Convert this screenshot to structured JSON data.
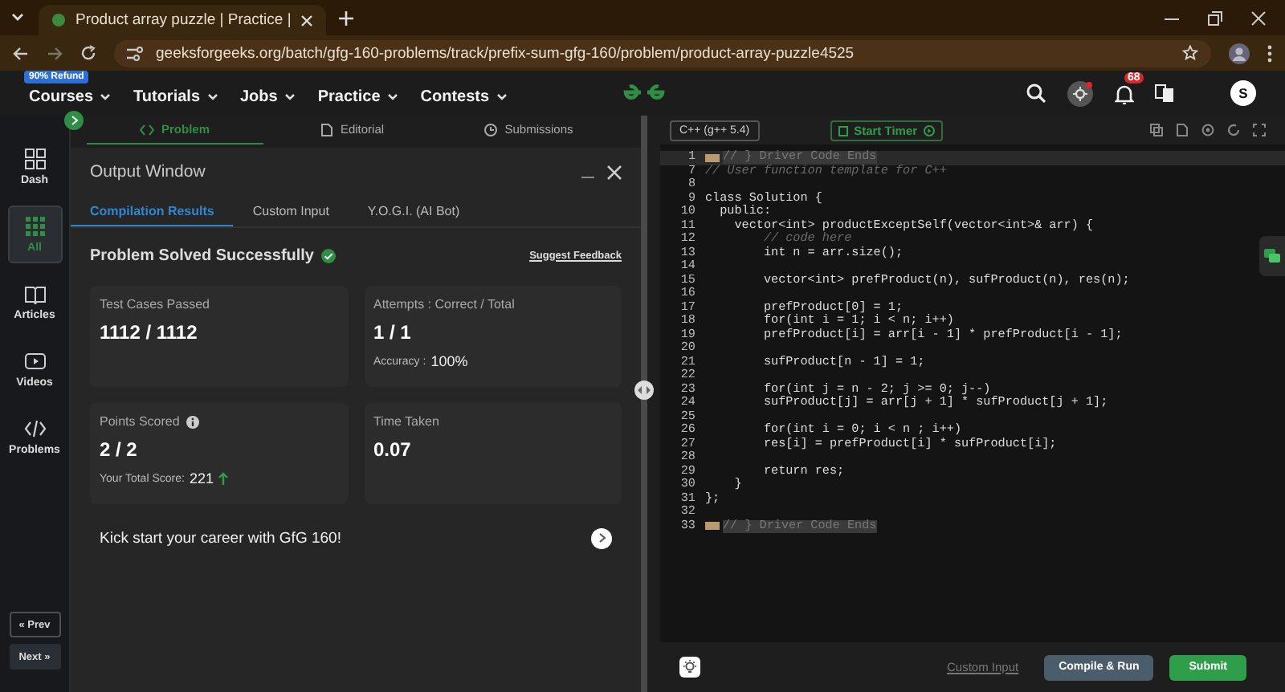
{
  "browser": {
    "tab_title": "Product array puzzle | Practice |",
    "url": "geeksforgeeks.org/batch/gfg-160-problems/track/prefix-sum-gfg-160/problem/product-array-puzzle4525"
  },
  "nav": {
    "badge": "90% Refund",
    "items": [
      "Courses",
      "Tutorials",
      "Jobs",
      "Practice",
      "Contests"
    ],
    "notification_count": "68",
    "avatar": "S"
  },
  "sidebar": {
    "items": [
      {
        "label": "Dash",
        "kind": "dash",
        "selected": false
      },
      {
        "label": "All",
        "kind": "grid",
        "selected": true
      },
      {
        "label": "Articles",
        "kind": "book",
        "selected": false
      },
      {
        "label": "Videos",
        "kind": "video",
        "selected": false
      },
      {
        "label": "Problems",
        "kind": "code",
        "selected": false
      }
    ],
    "prev": "« Prev",
    "next": "Next »"
  },
  "problem_tabs": [
    {
      "label": "Problem",
      "kind": "code",
      "selected": true
    },
    {
      "label": "Editorial",
      "kind": "doc",
      "selected": false
    },
    {
      "label": "Submissions",
      "kind": "clock",
      "selected": false
    }
  ],
  "output": {
    "title": "Output Window",
    "tabs": [
      {
        "label": "Compilation Results",
        "selected": true
      },
      {
        "label": "Custom Input",
        "selected": false
      },
      {
        "label": "Y.O.G.I. (AI Bot)",
        "selected": false
      }
    ],
    "status": "Problem Solved Successfully",
    "feedback_link": "Suggest Feedback",
    "cards": [
      {
        "label": "Test Cases Passed",
        "value": "1112 / 1112",
        "info": false
      },
      {
        "label": "Attempts : Correct / Total",
        "value": "1 / 1",
        "info": false,
        "note_label": "Accuracy :",
        "note_value": "100%",
        "rising": false
      },
      {
        "label": "Points Scored",
        "value": "2 / 2",
        "info": true,
        "note_label": "Your Total Score:",
        "note_value": "221",
        "rising": true
      },
      {
        "label": "Time Taken",
        "value": "0.07",
        "info": false
      }
    ],
    "promo": "Kick start your career with GfG 160!"
  },
  "editor": {
    "language": "C++ (g++ 5.4)",
    "timer": "Start Timer",
    "lines": [
      {
        "number": "1",
        "kind": "folded",
        "current": true,
        "text": "// } Driver Code Ends"
      },
      {
        "number": "7",
        "kind": "comment",
        "current": false,
        "text": "// User function template for C++"
      },
      {
        "number": "8",
        "current": false
      },
      {
        "number": "9",
        "kind": "code",
        "current": false,
        "text": "class Solution {"
      },
      {
        "number": "10",
        "kind": "code",
        "current": false,
        "text": "  public:"
      },
      {
        "number": "11",
        "kind": "code",
        "current": false,
        "text": "    vector<int> productExceptSelf(vector<int>& arr) {"
      },
      {
        "number": "12",
        "kind": "comment",
        "current": false,
        "text": "        // code here"
      },
      {
        "number": "13",
        "kind": "code",
        "current": false,
        "text": "        int n = arr.size();"
      },
      {
        "number": "14",
        "current": false
      },
      {
        "number": "15",
        "kind": "code",
        "current": false,
        "text": "        vector<int> prefProduct(n), sufProduct(n), res(n);"
      },
      {
        "number": "16",
        "current": false
      },
      {
        "number": "17",
        "kind": "code",
        "current": false,
        "text": "        prefProduct[0] = 1;"
      },
      {
        "number": "18",
        "kind": "code",
        "current": false,
        "text": "        for(int i = 1; i < n; i++)"
      },
      {
        "number": "19",
        "kind": "code",
        "current": false,
        "text": "        prefProduct[i] = arr[i - 1] * prefProduct[i - 1];"
      },
      {
        "number": "20",
        "current": false
      },
      {
        "number": "21",
        "kind": "code",
        "current": false,
        "text": "        sufProduct[n - 1] = 1;"
      },
      {
        "number": "22",
        "current": false
      },
      {
        "number": "23",
        "kind": "code",
        "current": false,
        "text": "        for(int j = n - 2; j >= 0; j--)"
      },
      {
        "number": "24",
        "kind": "code",
        "current": false,
        "text": "        sufProduct[j] = arr[j + 1] * sufProduct[j + 1];"
      },
      {
        "number": "25",
        "current": false
      },
      {
        "number": "26",
        "kind": "code",
        "current": false,
        "text": "        for(int i = 0; i < n ; i++)"
      },
      {
        "number": "27",
        "kind": "code",
        "current": false,
        "text": "        res[i] = prefProduct[i] * sufProduct[i];"
      },
      {
        "number": "28",
        "current": false
      },
      {
        "number": "29",
        "kind": "code",
        "current": false,
        "text": "        return res;"
      },
      {
        "number": "30",
        "kind": "code",
        "current": false,
        "text": "    }"
      },
      {
        "number": "31",
        "kind": "code",
        "current": false,
        "text": "};"
      },
      {
        "number": "32",
        "current": false
      },
      {
        "number": "33",
        "kind": "folded",
        "current": false,
        "text": "// } Driver Code Ends"
      }
    ],
    "custom_input": "Custom Input",
    "compile": "Compile & Run",
    "submit": "Submit"
  }
}
